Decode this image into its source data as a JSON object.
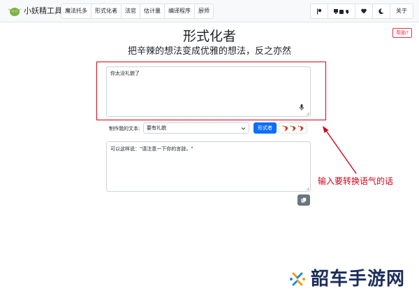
{
  "app": {
    "brand": "小妖精工具"
  },
  "nav": {
    "items": [
      "魔法托多",
      "形式化者",
      "法官",
      "估计量",
      "编译程序",
      "厨师"
    ]
  },
  "right_nav": {
    "items": [
      "",
      "",
      "",
      "",
      "关于"
    ]
  },
  "help_label": "帮助?",
  "page": {
    "title": "形式化者",
    "subtitle": "把辛辣的想法变成优雅的想法，反之亦然"
  },
  "input": {
    "value": "你太没礼貌了"
  },
  "controls": {
    "label": "制作我的文本:",
    "selected": "要有礼貌",
    "go_label": "形式者",
    "spice_level": 3
  },
  "output": {
    "value": "可以这样说：\"请注意一下你的言辞。\""
  },
  "annotation": {
    "text": "输入要转换语气的话"
  },
  "watermark": {
    "text": "韶车手游网"
  },
  "colors": {
    "primary": "#0d6efd",
    "highlight": "#d0021b",
    "secondary": "#6c757d",
    "logo_green": "#7cb342"
  },
  "icons": {
    "nav_right": [
      "flag-icon",
      "platform-icons",
      "heart-icon",
      "moon-icon"
    ],
    "input": "mic-icon",
    "select": "chevron-down-icon",
    "spice": "chili-pepper-icon",
    "output": "copy-icon"
  }
}
